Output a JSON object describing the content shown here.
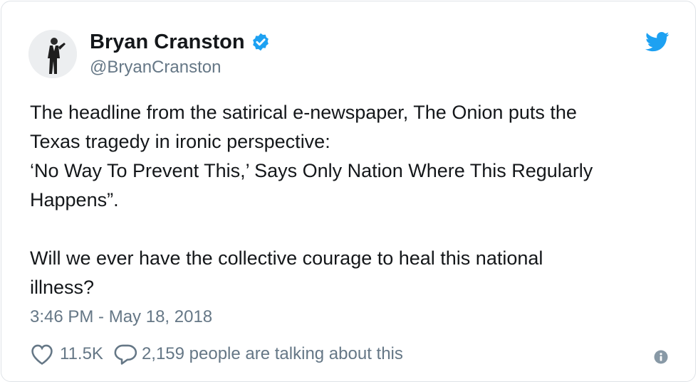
{
  "author": {
    "name": "Bryan Cranston",
    "handle": "@BryanCranston"
  },
  "tweet": {
    "line1": "The headline from the satirical e-newspaper, The Onion puts the",
    "line2": "Texas tragedy in ironic perspective:",
    "line3": "‘No Way To Prevent This,’ Says Only Nation Where This Regularly",
    "line4": "Happens”.",
    "line5": "Will we ever have the collective courage to heal this national",
    "line6": "illness?"
  },
  "timestamp": "3:46 PM - May 18, 2018",
  "actions": {
    "likes": "11.5K",
    "talking": "2,159 people are talking about this"
  },
  "colors": {
    "twitter_blue": "#1da1f2",
    "text": "#14171a",
    "secondary": "#657786"
  },
  "icons": [
    "avatar",
    "verified-badge-icon",
    "twitter-bird-icon",
    "heart-icon",
    "comment-bubble-icon",
    "info-icon"
  ]
}
